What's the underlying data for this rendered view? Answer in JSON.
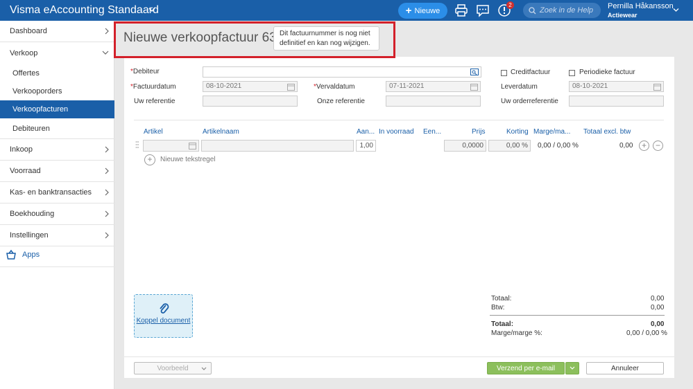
{
  "app": {
    "title": "Visma eAccounting Standaard"
  },
  "topbar": {
    "new_label": "Nieuwe",
    "notification_count": "2",
    "help_placeholder": "Zoek in de Help",
    "user_name": "Pernilla Håkansson",
    "company": "Actiewear"
  },
  "sidebar": {
    "items": [
      {
        "label": "Dashboard"
      },
      {
        "label": "Verkoop"
      },
      {
        "label": "Inkoop"
      },
      {
        "label": "Voorraad"
      },
      {
        "label": "Kas- en banktransacties"
      },
      {
        "label": "Boekhouding"
      },
      {
        "label": "Instellingen"
      }
    ],
    "sub_items": [
      {
        "label": "Offertes"
      },
      {
        "label": "Verkooporders"
      },
      {
        "label": "Verkoopfacturen",
        "active": true
      },
      {
        "label": "Debiteuren"
      }
    ],
    "apps_label": "Apps"
  },
  "page": {
    "title": "Nieuwe verkoopfactuur 63*",
    "tooltip_line1": "Dit factuurnummer is nog niet",
    "tooltip_line2": "definitief en kan nog wijzigen."
  },
  "form": {
    "debiteur_label": "Debiteur",
    "factuurdatum_label": "Factuurdatum",
    "factuurdatum_value": "08-10-2021",
    "vervaldatum_label": "Vervaldatum",
    "vervaldatum_value": "07-11-2021",
    "uw_referentie_label": "Uw referentie",
    "onze_referentie_label": "Onze referentie",
    "creditfactuur_label": "Creditfactuur",
    "periodieke_label": "Periodieke factuur",
    "leverdatum_label": "Leverdatum",
    "leverdatum_value": "08-10-2021",
    "uw_order_label": "Uw orderreferentie",
    "required_mark": "*"
  },
  "lines": {
    "columns": {
      "artikel": "Artikel",
      "artikelnaam": "Artikelnaam",
      "aantal": "Aan...",
      "in_voorraad": "In voorraad",
      "eenheid": "Een...",
      "prijs": "Prijs",
      "korting": "Korting",
      "marge": "Marge/ma...",
      "totaal": "Totaal excl. btw"
    },
    "row": {
      "aantal": "1,00",
      "prijs": "0,0000",
      "korting": "0,00 %",
      "marge": "0,00 / 0,00 %",
      "totaal": "0,00"
    },
    "new_text_row": "Nieuwe tekstregel"
  },
  "attach": {
    "label": "Koppel document"
  },
  "totals": {
    "totaal_label": "Totaal:",
    "totaal_value": "0,00",
    "btw_label": "Btw:",
    "btw_value": "0,00",
    "grand_label": "Totaal:",
    "grand_value": "0,00",
    "marge_label": "Marge/marge %:",
    "marge_value": "0,00 / 0,00 %"
  },
  "footer": {
    "preview_label": "Voorbeeld",
    "email_label": "Verzend per e-mail",
    "cancel_label": "Annuleer"
  },
  "colors": {
    "brand": "#1a5fa8",
    "accent": "#2b8ee8",
    "success": "#8cbf5c",
    "highlight": "#d3202a"
  }
}
